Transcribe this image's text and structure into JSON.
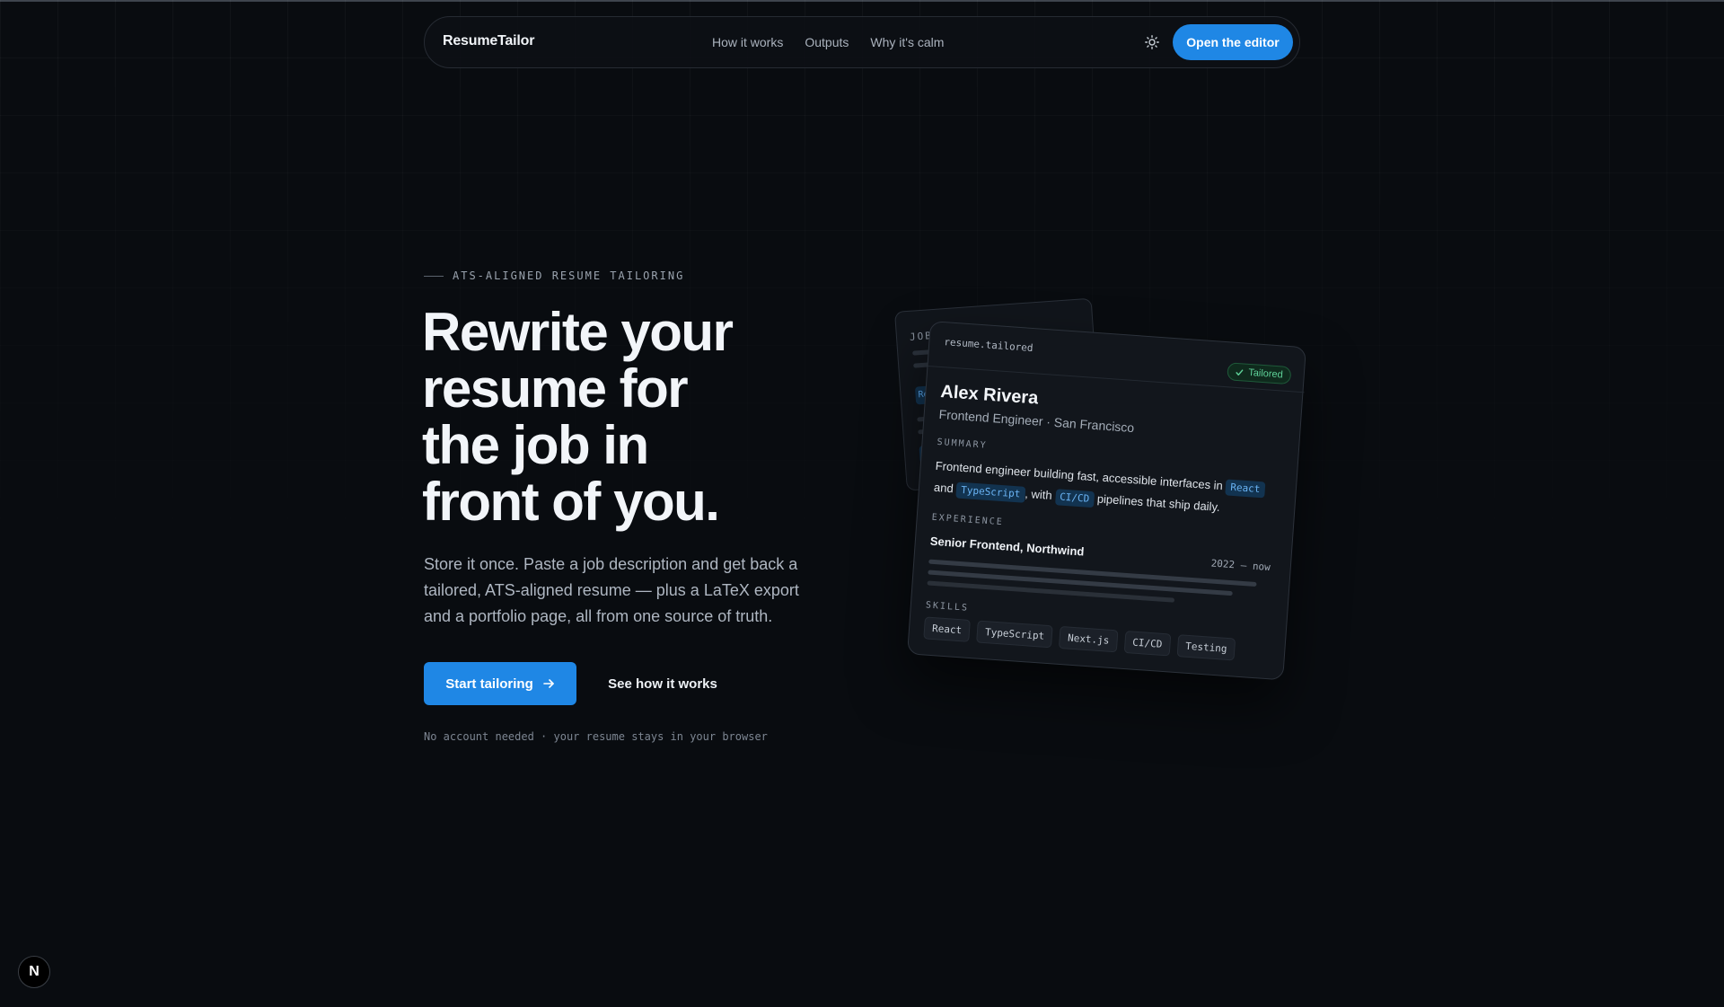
{
  "nav": {
    "brand": "ResumeTailor",
    "links": [
      "How it works",
      "Outputs",
      "Why it's calm"
    ],
    "theme_icon": "sun-icon",
    "cta": "Open the editor"
  },
  "hero": {
    "eyebrow": "ATS-ALIGNED RESUME TAILORING",
    "headline": [
      "Rewrite your",
      "resume for",
      "the job in",
      "front of you."
    ],
    "lede": "Store it once. Paste a job description and get back a tailored, ATS-aligned resume — plus a LaTeX export and a portfolio page, all from one source of truth.",
    "primary_cta": "Start tailoring",
    "primary_cta_icon": "arrow-right-icon",
    "secondary_cta": "See how it works",
    "fineprint": "No account needed · your resume stays in your browser"
  },
  "back_card": {
    "label": "JOB",
    "tag": "Re"
  },
  "resume_card": {
    "file": "resume.tailored",
    "badge": "Tailored",
    "name": "Alex Rivera",
    "role": "Frontend Engineer · San Francisco",
    "summary_label": "SUMMARY",
    "summary": {
      "t1": "Frontend engineer building fast, accessible interfaces in ",
      "k1": "React",
      "t2": " and ",
      "k2": "TypeScript",
      "t3": ", with ",
      "k3": "CI/CD",
      "t4": " pipelines that ship daily."
    },
    "experience_label": "EXPERIENCE",
    "job_title": "Senior Frontend, Northwind",
    "job_dates": "2022 – now",
    "skills_label": "SKILLS",
    "skills": [
      "React",
      "TypeScript",
      "Next.js",
      "CI/CD",
      "Testing"
    ]
  },
  "dev_badge": "N",
  "colors": {
    "background": "#090c10",
    "accent": "#1f87e5",
    "keyword": "#6ab4f5",
    "success": "#5fd39a"
  }
}
